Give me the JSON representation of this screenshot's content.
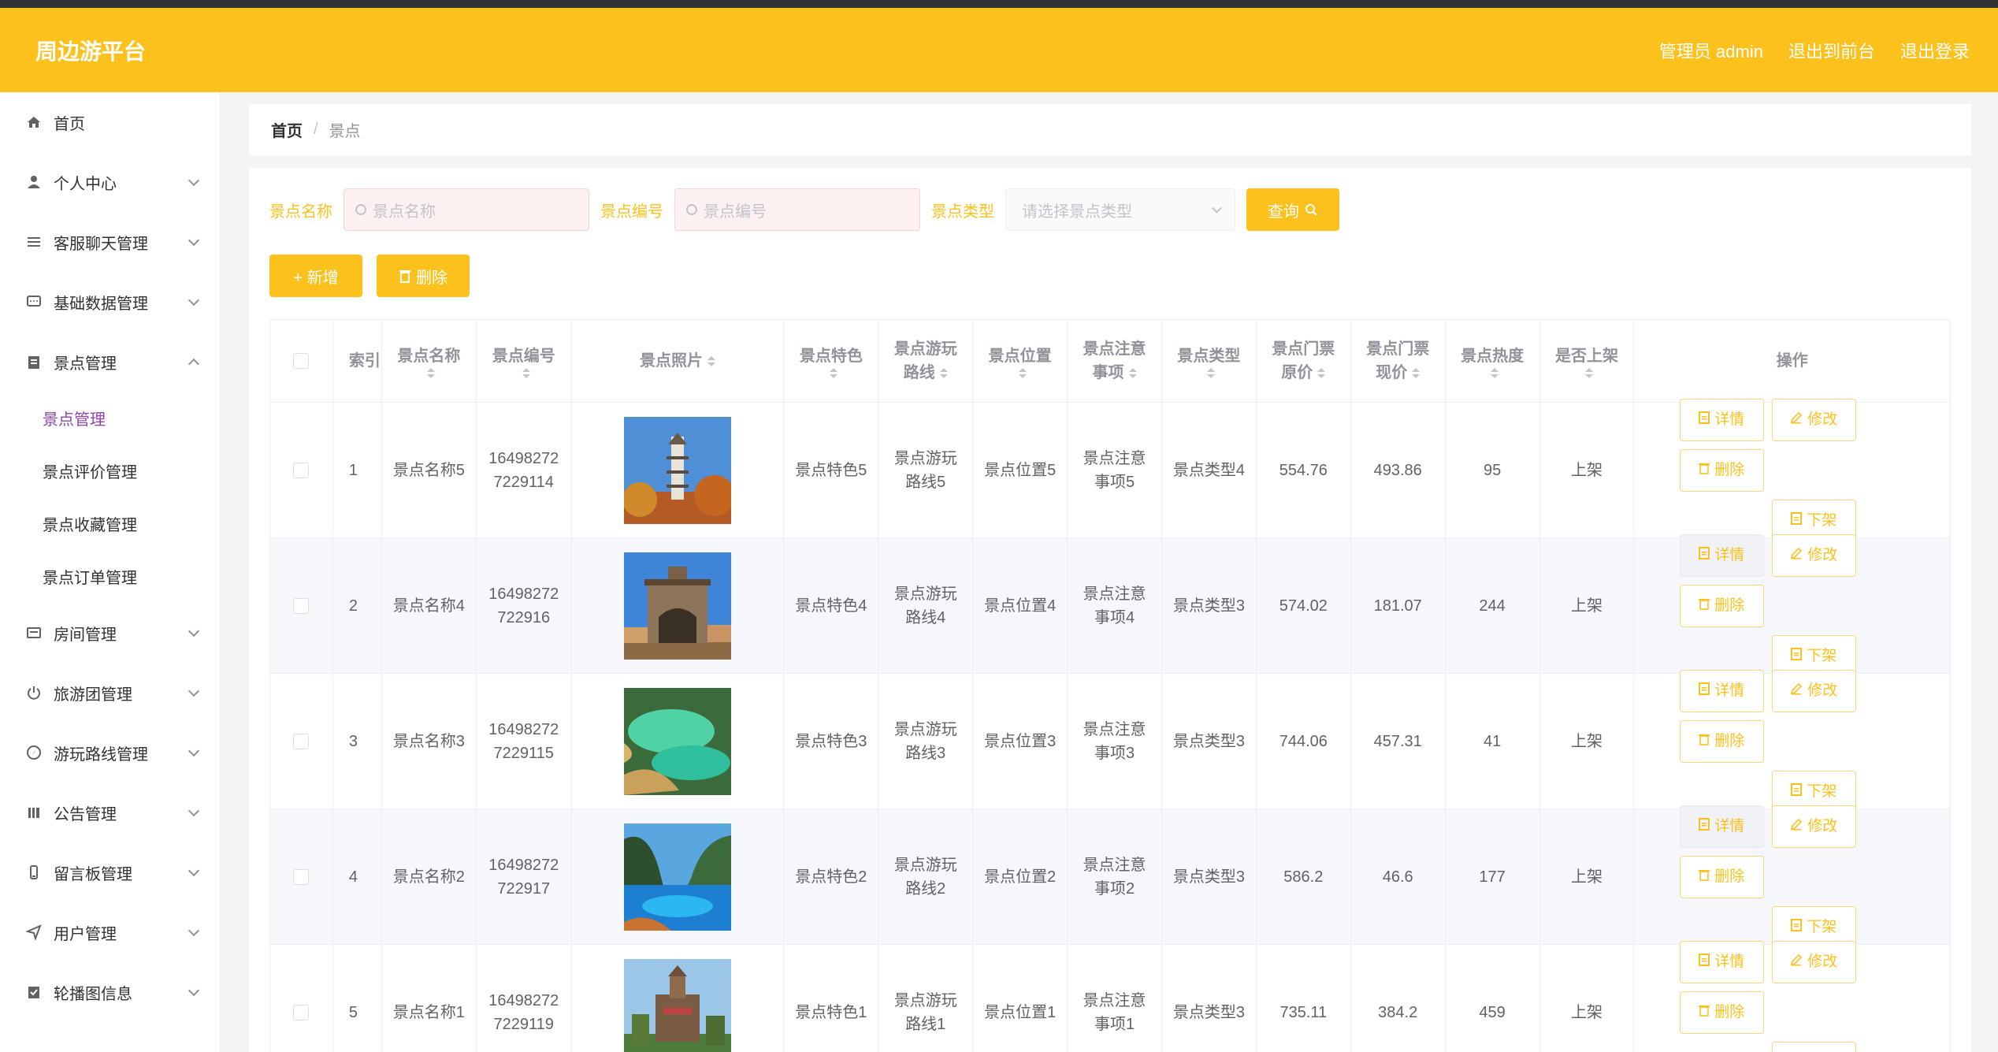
{
  "header": {
    "brand": "周边游平台",
    "admin": "管理员 admin",
    "to_front": "退出到前台",
    "logout": "退出登录"
  },
  "sidebar": {
    "items": [
      {
        "label": "首页",
        "icon": "home-icon"
      },
      {
        "label": "个人中心",
        "icon": "user-icon"
      },
      {
        "label": "客服聊天管理",
        "icon": "list-icon"
      },
      {
        "label": "基础数据管理",
        "icon": "chat-icon"
      },
      {
        "label": "景点管理",
        "icon": "clipboard-icon"
      },
      {
        "label": "房间管理",
        "icon": "card-icon"
      },
      {
        "label": "旅游团管理",
        "icon": "power-icon"
      },
      {
        "label": "游玩路线管理",
        "icon": "compass-icon"
      },
      {
        "label": "公告管理",
        "icon": "bars-icon"
      },
      {
        "label": "留言板管理",
        "icon": "phone-icon"
      },
      {
        "label": "用户管理",
        "icon": "send-icon"
      },
      {
        "label": "轮播图信息",
        "icon": "doc-icon"
      }
    ],
    "subitems": [
      "景点管理",
      "景点评价管理",
      "景点收藏管理",
      "景点订单管理"
    ]
  },
  "breadcrumb": {
    "home": "首页",
    "sep": "/",
    "current": "景点"
  },
  "filters": {
    "name_label": "景点名称",
    "name_placeholder": "景点名称",
    "no_label": "景点编号",
    "no_placeholder": "景点编号",
    "type_label": "景点类型",
    "type_placeholder": "请选择景点类型",
    "query": "查询"
  },
  "actions": {
    "add": "+ 新增",
    "delete": "删除"
  },
  "table": {
    "headers": {
      "index": "索引",
      "name": "景点名称",
      "no": "景点编号",
      "photo": "景点照片",
      "feature": "景点特色",
      "route_1": "景点游玩",
      "route_2": "路线",
      "pos": "景点位置",
      "note_1": "景点注意",
      "note_2": "事项",
      "type": "景点类型",
      "orig_1": "景点门票",
      "orig_2": "原价",
      "now_1": "景点门票",
      "now_2": "现价",
      "heat": "景点热度",
      "shelf": "是否上架",
      "ops": "操作"
    },
    "op_labels": {
      "detail": "详情",
      "edit": "修改",
      "delete": "删除",
      "off": "下架"
    },
    "rows": [
      {
        "idx": "1",
        "name": "景点名称5",
        "no_1": "16498272",
        "no_2": "7229114",
        "feature": "景点特色5",
        "route_1": "景点游玩",
        "route_2": "路线5",
        "pos": "景点位置5",
        "note_1": "景点注意",
        "note_2": "事项5",
        "type": "景点类型4",
        "orig": "554.76",
        "now": "493.86",
        "heat": "95",
        "shelf": "上架",
        "photo": "pagoda"
      },
      {
        "idx": "2",
        "name": "景点名称4",
        "no_1": "16498272",
        "no_2": "722916",
        "feature": "景点特色4",
        "route_1": "景点游玩",
        "route_2": "路线4",
        "pos": "景点位置4",
        "note_1": "景点注意",
        "note_2": "事项4",
        "type": "景点类型3",
        "orig": "574.02",
        "now": "181.07",
        "heat": "244",
        "shelf": "上架",
        "photo": "gate"
      },
      {
        "idx": "3",
        "name": "景点名称3",
        "no_1": "16498272",
        "no_2": "7229115",
        "feature": "景点特色3",
        "route_1": "景点游玩",
        "route_2": "路线3",
        "pos": "景点位置3",
        "note_1": "景点注意",
        "note_2": "事项3",
        "type": "景点类型3",
        "orig": "744.06",
        "now": "457.31",
        "heat": "41",
        "shelf": "上架",
        "photo": "pools"
      },
      {
        "idx": "4",
        "name": "景点名称2",
        "no_1": "16498272",
        "no_2": "722917",
        "feature": "景点特色2",
        "route_1": "景点游玩",
        "route_2": "路线2",
        "pos": "景点位置2",
        "note_1": "景点注意",
        "note_2": "事项2",
        "type": "景点类型3",
        "orig": "586.2",
        "now": "46.6",
        "heat": "177",
        "shelf": "上架",
        "photo": "lake"
      },
      {
        "idx": "5",
        "name": "景点名称1",
        "no_1": "16498272",
        "no_2": "7229119",
        "feature": "景点特色1",
        "route_1": "景点游玩",
        "route_2": "路线1",
        "pos": "景点位置1",
        "note_1": "景点注意",
        "note_2": "事项1",
        "type": "景点类型3",
        "orig": "735.11",
        "now": "384.2",
        "heat": "459",
        "shelf": "上架",
        "photo": "castle"
      }
    ]
  }
}
